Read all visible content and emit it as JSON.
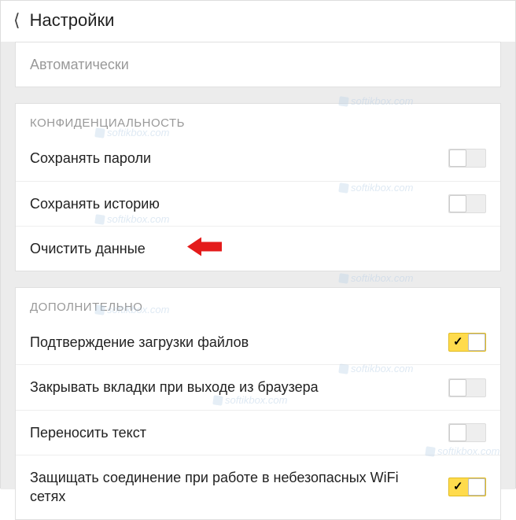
{
  "header": {
    "title": "Настройки"
  },
  "first_panel": {
    "item": "Автоматически"
  },
  "privacy": {
    "section_title": "КОНФИДЕНЦИАЛЬНОСТЬ",
    "save_passwords": {
      "label": "Сохранять пароли",
      "enabled": false
    },
    "save_history": {
      "label": "Сохранять историю",
      "enabled": false
    },
    "clear_data": {
      "label": "Очистить данные"
    }
  },
  "additional": {
    "section_title": "ДОПОЛНИТЕЛЬНО",
    "confirm_download": {
      "label": "Подтверждение загрузки файлов",
      "enabled": true
    },
    "close_tabs_on_exit": {
      "label": "Закрывать вкладки при выходе из браузера",
      "enabled": false
    },
    "wrap_text": {
      "label": "Переносить текст",
      "enabled": false
    },
    "protect_wifi": {
      "label": "Защищать соединение при работе в небезопасных WiFi сетях",
      "enabled": true
    }
  },
  "watermark_text": "softikbox.com"
}
